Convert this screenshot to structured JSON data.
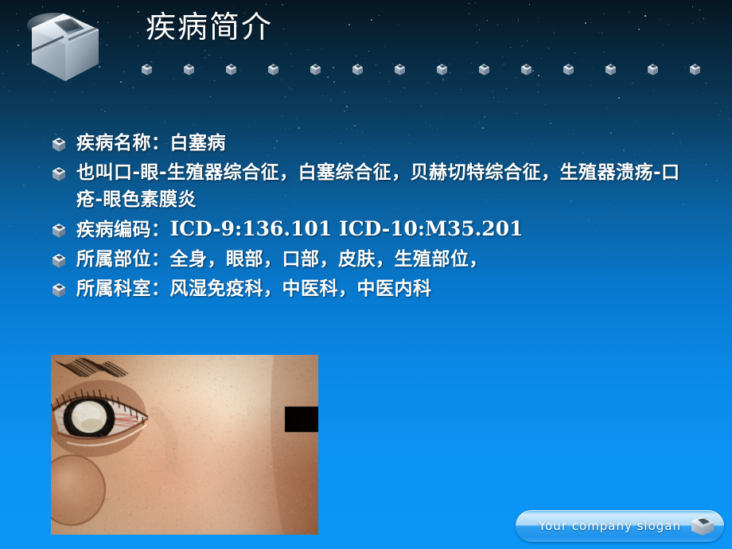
{
  "slide": {
    "title": "疾病简介",
    "logo_icon": "metal-cube-logo",
    "background": {
      "top_color": "#061622",
      "bottom_color": "#0b96f8"
    }
  },
  "header": {
    "divider_cube_icon": "mini-cube-icon",
    "divider_cube_count": 14
  },
  "bullets": [
    {
      "icon": "cube-bullet-icon",
      "segments": [
        {
          "text": "疾病名称：白塞病",
          "style": "normal"
        }
      ]
    },
    {
      "icon": "cube-bullet-icon",
      "segments": [
        {
          "text": "也叫口-眼-生殖器综合征，白塞综合征，贝赫切特综合征，生殖器溃疡-口疮-眼色素膜炎",
          "style": "normal"
        }
      ]
    },
    {
      "icon": "cube-bullet-icon",
      "segments": [
        {
          "text": "疾病编码：",
          "style": "normal"
        },
        {
          "text": "ICD-9:136.101 ICD-10:M35.201",
          "style": "code"
        }
      ]
    },
    {
      "icon": "cube-bullet-icon",
      "segments": [
        {
          "text": "所属部位：全身，眼部，口部，皮肤，生殖部位，",
          "style": "normal"
        }
      ]
    },
    {
      "icon": "cube-bullet-icon",
      "segments": [
        {
          "text": "所属科室：风湿免疫科，中医科，中医内科",
          "style": "normal"
        }
      ]
    }
  ],
  "photo": {
    "alt": "clinical-photo-eye-hypopyon-behcet",
    "description": "临床照片：眼部前房积脓"
  },
  "footer": {
    "slogan": "Your company slogan",
    "icon": "metal-cube-icon"
  },
  "colors": {
    "accent_blue": "#0b93f4",
    "dark_navy": "#061622",
    "text_white": "#ffffff",
    "slogan_bar_light": "#cfe9fb"
  }
}
